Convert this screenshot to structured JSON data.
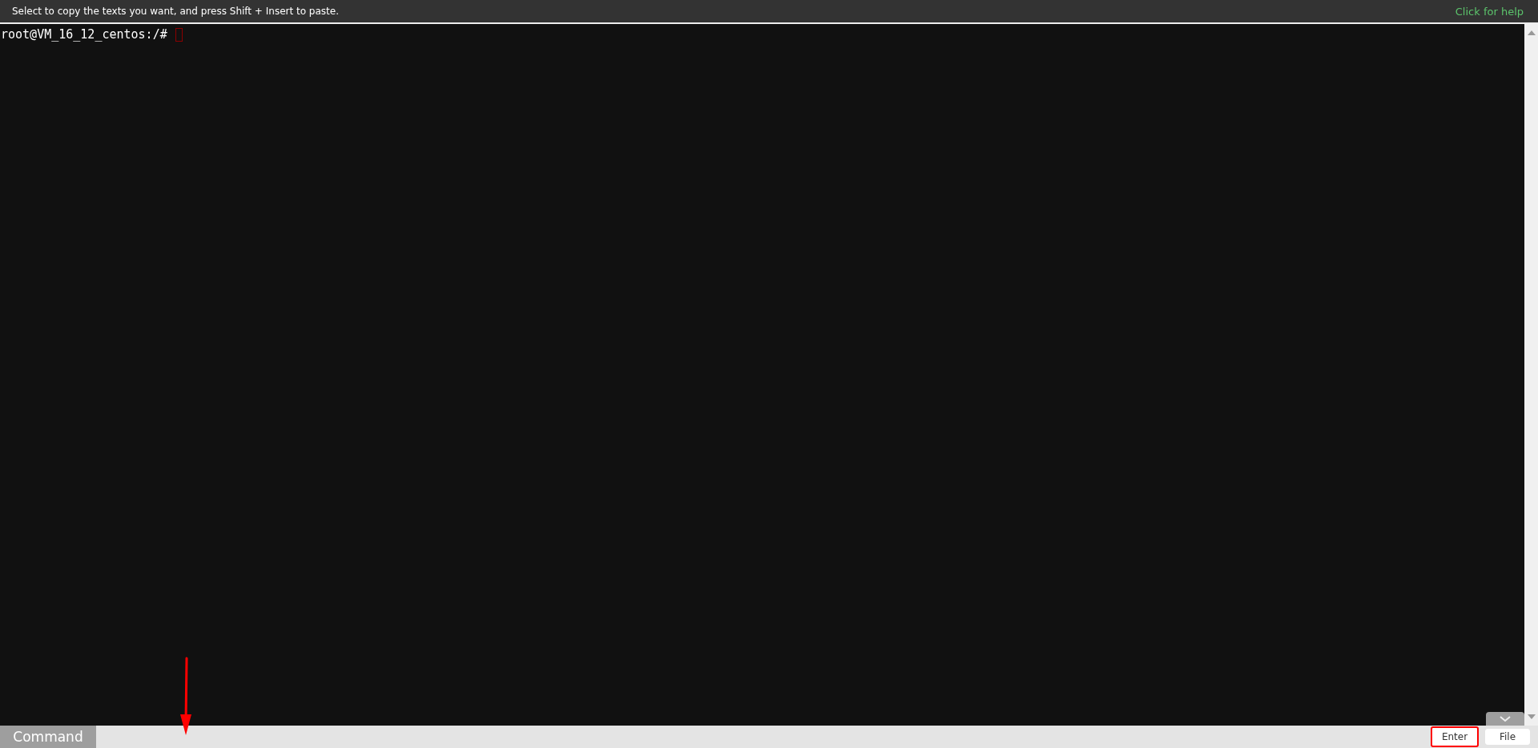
{
  "top_bar": {
    "hint": "Select to copy the texts you want, and press Shift + Insert to paste.",
    "help_link": "Click for help"
  },
  "terminal": {
    "prompt": "root@VM_16_12_centos:/#"
  },
  "command_bar": {
    "label": "Command",
    "buttons": [
      {
        "label": "Enter",
        "highlighted": true
      },
      {
        "label": "File",
        "highlighted": false
      }
    ]
  }
}
